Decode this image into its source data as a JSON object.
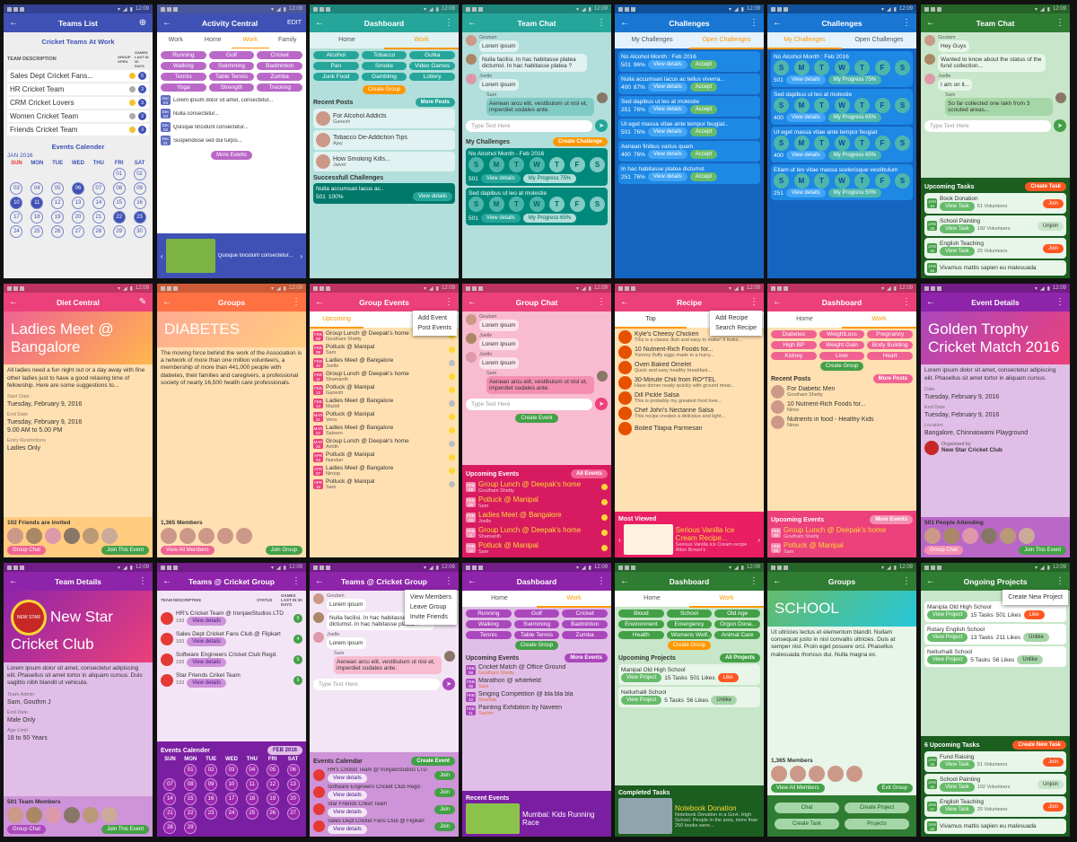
{
  "status_time": "12:09",
  "colors": {
    "indigo": "#3f51b5",
    "teal": "#26a69a",
    "blue": "#1565c0",
    "pink": "#ec407a",
    "orange": "#ff9800",
    "purple": "#8e24aa",
    "green": "#2e7d32"
  },
  "s1": {
    "title": "Teams List",
    "heading": "Cricket Teams At Work",
    "col_desc": "TEAM DESCRIPTION",
    "col_group": "GROUP OPEN",
    "col_games": "GAMES LAST IN 30 DAYS",
    "teams": [
      {
        "name": "Sales Dept Cricket Fans...",
        "n": "5"
      },
      {
        "name": "HR Cricket Team",
        "n": "3"
      },
      {
        "name": "CRM Cricket Lovers",
        "n": "3"
      },
      {
        "name": "Women Cricket Team",
        "n": "3"
      },
      {
        "name": "Friends Cricket Team",
        "n": "3"
      }
    ],
    "cal_title": "Events Calender",
    "month": "JAN 2016",
    "days": [
      "SUN",
      "MON",
      "TUE",
      "WED",
      "THU",
      "FRI",
      "SAT"
    ],
    "dates": [
      "",
      "",
      "",
      "",
      "",
      "01",
      "02",
      "03",
      "04",
      "05",
      "06",
      "07",
      "08",
      "09",
      "10",
      "11",
      "12",
      "13",
      "14",
      "15",
      "16",
      "17",
      "18",
      "19",
      "20",
      "21",
      "22",
      "23",
      "24",
      "25",
      "26",
      "27",
      "28",
      "29",
      "30"
    ]
  },
  "s2": {
    "title": "Activity Central",
    "action": "EDIT",
    "tabs": [
      "Work",
      "Home",
      "Work",
      "Family"
    ],
    "chips": [
      "Running",
      "Golf",
      "Cricket",
      "Walking",
      "Swimming",
      "Badminton",
      "Tennis",
      "Table Tennis",
      "Zumba",
      "Yoga",
      "Strength",
      "Trecking"
    ],
    "news": [
      {
        "d": "Dec 04",
        "t": "Lorem ipsum dolor sit amet, consectetur..."
      },
      {
        "d": "Dec 03",
        "t": "Nulla consectetur..."
      },
      {
        "d": "Dec 02",
        "t": "Quisque tincidunt consectetur..."
      },
      {
        "d": "Dec 01",
        "t": "Suspendisse sed dui turpis..."
      }
    ],
    "more": "More Events",
    "banner": "Quisque tincidunt consectetur..."
  },
  "s3": {
    "title": "Dashboard",
    "tabs": [
      "Home",
      "Work"
    ],
    "chips": [
      "Alcohol",
      "Tobacco",
      "Gutka",
      "Pan",
      "Smoke",
      "Video Games",
      "Junk Food",
      "Gambling",
      "Lottery"
    ],
    "create": "Create Group",
    "recent": "Recent Posts",
    "more": "More Posts",
    "posts": [
      {
        "t": "For Alcohol Addicts",
        "a": "Ganesh"
      },
      {
        "t": "Tobacco De-Addiction Tips",
        "a": "Ajay"
      },
      {
        "t": "How Smoking Kills...",
        "a": "Jaivet"
      }
    ],
    "sc": "Successfull Challenges",
    "sc_item": "Nulla accumsan lacus ac..",
    "sc_stats": "501",
    "sc_pct": "100%",
    "details": "View details"
  },
  "s4": {
    "title": "Team Chat",
    "msgs": [
      {
        "n": "Goutam",
        "t": "Lorem ipsum"
      },
      {
        "n": "",
        "t": "Nulla facilisi. In hac habitasse platea dictumst. In hac habitasse platea ?"
      },
      {
        "n": "Joelle",
        "t": "Lorem ipsum"
      },
      {
        "n": "Sam",
        "t": "Aenean arcu elit, vestibulum ut nisl et, imperdiet sodales ante."
      }
    ],
    "placeholder": "Type Text Here",
    "my": "My Challenges",
    "create": "Create Challenge",
    "c1": "No Alcohol Month - Feb 2016",
    "c2": "Sed dapibus ut leo at molestie",
    "smt": [
      "S",
      "M",
      "T",
      "W",
      "T",
      "F",
      "S"
    ],
    "stat": "501",
    "details": "View details",
    "progress": "My Progress 75%",
    "progress2": "My Progress 65%"
  },
  "s5": {
    "title": "Challenges",
    "tabs": [
      "My Challenges",
      "Open Challenges"
    ],
    "items": [
      {
        "t": "No Alcohol Month : Feb 2016",
        "c": "501",
        "p": "96%"
      },
      {
        "t": "Nulla accumsan lacus ac tellus viverra...",
        "c": "400",
        "p": "87%"
      },
      {
        "t": "Sed dapibus ut leo at molestie",
        "c": "251",
        "p": "76%"
      },
      {
        "t": "Ut eget massa vitae ante tempor feugiat..",
        "c": "501",
        "p": "76%"
      },
      {
        "t": "Aenean finibus varius quam",
        "c": "400",
        "p": "76%"
      },
      {
        "t": "In hac habitasse platea dictumst",
        "c": "251",
        "p": "76%"
      }
    ],
    "details": "View details",
    "accept": "Accept"
  },
  "s6": {
    "title": "Challenges",
    "tabs": [
      "My Challenges",
      "Open Challenges"
    ],
    "items": [
      {
        "t": "No Alcohol Month : Feb 2016",
        "c": "501",
        "p": "My Progress 75%"
      },
      {
        "t": "Sed dapibus ut leo at molestie",
        "c": "400",
        "p": "My Progress 65%"
      },
      {
        "t": "Ut eget massa vitae ante tempor feugiat",
        "c": "400",
        "p": "My Progress 65%"
      },
      {
        "t": "Etiam ut leo vitae massa scelerisque vestibulum",
        "c": "251",
        "p": "My Progress 50%"
      }
    ],
    "details": "View details",
    "smt": [
      "S",
      "M",
      "T",
      "W",
      "T",
      "F",
      "S"
    ]
  },
  "s7": {
    "title": "Team Chat",
    "msgs": [
      {
        "n": "Goutam",
        "t": "Hey Guys"
      },
      {
        "n": "",
        "t": "Wanted to know about the status of the fund collection..."
      },
      {
        "n": "Joelle",
        "t": "I am on it..."
      },
      {
        "n": "Sam",
        "t": "So far collected one lakh from 3 scouted areas..."
      }
    ],
    "placeholder": "Type Text Here",
    "up": "Upcoming Tasks",
    "create": "Create Task",
    "tasks": [
      {
        "d": "JAN 15",
        "t": "Book Donation",
        "v": "51 Volunteers",
        "b": "Join"
      },
      {
        "d": "JAN 15",
        "t": "School Painting",
        "v": "192 Volunteers",
        "b": "Unjoin"
      },
      {
        "d": "JAN 15",
        "t": "English Teaching",
        "v": "25 Volunteers",
        "b": "Join"
      },
      {
        "d": "JAN 15",
        "t": "Vivamus mattis sapien eu malesuada",
        "v": "",
        "b": ""
      }
    ],
    "view": "View Task"
  },
  "s8": {
    "title": "Diet Central",
    "hero": "Ladies Meet @ Bangalore",
    "desc": "All ladies need a fun night out or a day away with fine other ladies just to have a good relaxing time of fellowship. Here are some suggestions to...",
    "sd_l": "Start Date",
    "sd": "Tuesday, February 9, 2016",
    "ed_l": "End Date",
    "ed": "Tuesday, February 9, 2016",
    "time": "9.00 AM to 5.00 PM",
    "er_l": "Entry Restrictions",
    "er": "Ladies Only",
    "inv": "102 Friends are invited",
    "chat": "Group Chat",
    "join": "Join This Event"
  },
  "s9": {
    "title": "Groups",
    "hero": "DIABETES",
    "desc": "The moving force behind the work of the Association is a network of more than one million volunteers, a membership of more than 441,000 people with diabetes, their families and caregivers, a professional society of nearly 16,500 health care professionals.",
    "members": "1,365 Members",
    "view": "View All Members",
    "join": "Join Group"
  },
  "s10": {
    "title": "Group Events",
    "menu": [
      "Add Event",
      "Post Events"
    ],
    "tab": "Upcoming",
    "events": [
      {
        "d": "FEB 08",
        "t": "Group Lunch @ Deepak's home",
        "b": "Goutham Shetty"
      },
      {
        "d": "FEB 09",
        "t": "Potluck @ Manipal",
        "b": "Sam"
      },
      {
        "d": "FEB 10",
        "t": "Ladies Meet @ Bangalore",
        "b": "Joelle"
      },
      {
        "d": "FEB 11",
        "t": "Group Lunch @ Deepak's home",
        "b": "Shamanth"
      },
      {
        "d": "FEB 12",
        "t": "Potluck @ Manipal",
        "b": "Ganesh"
      },
      {
        "d": "FEB 14",
        "t": "Ladies Meet @ Bangalore",
        "b": "Maddi"
      },
      {
        "d": "MAR 21",
        "t": "Potluck @ Manipal",
        "b": "Venu"
      },
      {
        "d": "MAR 22",
        "t": "Ladies Meet @ Bangalore",
        "b": "Saleem"
      },
      {
        "d": "MAR 25",
        "t": "Group Lunch @ Deepak's home",
        "b": "Amith"
      },
      {
        "d": "APR 03",
        "t": "Potluck @ Manipal",
        "b": "Nandan"
      },
      {
        "d": "APR 07",
        "t": "Ladies Meet @ Bangalore",
        "b": "Niroop"
      },
      {
        "d": "APR 15",
        "t": "Potluck @ Manipal",
        "b": "Sam"
      }
    ],
    "created": "Created by"
  },
  "s11": {
    "title": "Group Chat",
    "msgs": [
      {
        "n": "Goutam",
        "t": "Lorem ipsum"
      },
      {
        "n": "Joelle",
        "t": "Lorem ipsum"
      },
      {
        "n": "Joelle",
        "t": "Lorem ipsum"
      },
      {
        "n": "Sam",
        "t": "Aenean arcu elit, vestibulum ut nisl et, imperdiet sodales ante."
      }
    ],
    "placeholder": "Type Text Here",
    "create": "Create Event",
    "up": "Upcoming Events",
    "all": "All Events",
    "events": [
      {
        "d": "FEB 08",
        "t": "Group Lunch @ Deepak's home",
        "b": "Goutham Shetty"
      },
      {
        "d": "FEB 09",
        "t": "Potluck @ Manipal",
        "b": "Sam"
      },
      {
        "d": "FEB 10",
        "t": "Ladies Meet @ Bangalore",
        "b": "Joelle"
      },
      {
        "d": "FEB 11",
        "t": "Group Lunch @ Deepak's home",
        "b": "Shamanth"
      },
      {
        "d": "FEB 12",
        "t": "Potluck @ Manipal",
        "b": "Sam"
      }
    ]
  },
  "s12": {
    "title": "Recipe",
    "menu": [
      "Add Recipe",
      "Search Recipe"
    ],
    "tab": "Top",
    "items": [
      {
        "t": "Kyle's Cheesy Chicken",
        "s": "This is a classic dish and easy to make! It looks..."
      },
      {
        "t": "10 Nutrient-Rich Foods for...",
        "s": "Yummy fluffy eggs made in a hurry..."
      },
      {
        "t": "Oven Baked Omelet",
        "s": "Quick and easy healthy breakfast..."
      },
      {
        "t": "30-Minute Chili from RO*TEL",
        "s": "Have dinner ready quickly with ground meat..."
      },
      {
        "t": "Dill Pickle Salsa",
        "s": "This is probably my greatest food love..."
      },
      {
        "t": "Chef John's Nectarine Salsa",
        "s": "This recipe creates a delicious and light..."
      },
      {
        "t": "Boiled Tilapia Parmesan",
        "s": ""
      }
    ],
    "mv": "Most Viewed",
    "mv_t": "Serious Vanilla Ice Cream Recipe...",
    "mv_s": "Serious Vanilla Ice Cream recipe Alton Brown's"
  },
  "s13": {
    "title": "Dashboard",
    "tabs": [
      "Home",
      "Work"
    ],
    "chips": [
      "Diabetes",
      "WeightLoss",
      "Pregnancy",
      "High BP",
      "Weight Gain",
      "Body Building",
      "Kidney",
      "Liver",
      "Heart"
    ],
    "create": "Create Group",
    "recent": "Recent Posts",
    "more": "More Posts",
    "posts": [
      {
        "t": "For Diabetic Men",
        "a": "Goutham Shetty"
      },
      {
        "t": "10 Nutrient-Rich Foods for...",
        "a": "Niroo"
      },
      {
        "t": "Nutrients in food - Healthy Kids",
        "a": "Niroo"
      }
    ],
    "up": "Upcoming Events",
    "more_ev": "More Events",
    "events": [
      {
        "d": "FEB 08",
        "t": "Group Lunch @ Deepak's home",
        "b": "Goutham Shetty"
      },
      {
        "d": "FEB 09",
        "t": "Potluck @ Manipal",
        "b": "Sam"
      }
    ]
  },
  "s14": {
    "title": "Event Details",
    "hero": "Golden Trophy Cricket Match 2016",
    "desc": "Lorem ipsum dolor sit amet, consectetur adipiscing elit. Phasellus sit amet tortor in aliquam cursus.",
    "d_l": "Date",
    "d": "Tuesday, February 9, 2016",
    "ed_l": "End Date",
    "ed": "Tuesday, February 9, 2016",
    "loc_l": "Location",
    "loc": "Bangalore, Chinnaswami Playground",
    "org_l": "Organised by",
    "org": "New Star Cricket Club",
    "att": "501 People Attending",
    "chat": "Group Chat",
    "join": "Join This Event"
  },
  "s15": {
    "title": "Team Details",
    "hero": "New Star Cricket Club",
    "logo": "NEW STAR",
    "desc": "Lorem ipsum dolor sit amet, consectetur adipiscing elit. Phasellus sit amet tortor in aliquam cursus. Duis sagittis nibh blandit ut vehicula.",
    "ad_l": "Team Admin",
    "ad": "Sam, Gouthm J",
    "ed_l": "End Date",
    "ed": "Male Only",
    "age_l": "Age Limit",
    "age": "18 to 50 Years",
    "members": "501 Team Members",
    "chat": "Group Chat",
    "join": "Join This Event"
  },
  "s16": {
    "title": "Teams @ Cricket Group",
    "cols": [
      "TEAM DESCRIPTION",
      "STATUS",
      "GAMES LAST IN 30 DAYS"
    ],
    "teams": [
      {
        "t": "HR's Cricket Team @ IronjawStudios LTD",
        "c": "193",
        "n": "5"
      },
      {
        "t": "Sales Dept Cricket Fans Club @ Flipkart",
        "c": "193",
        "n": "4"
      },
      {
        "t": "Software Engineers Cricket Club Regd.",
        "c": "193",
        "n": "5"
      },
      {
        "t": "Star Friends Criket Team",
        "c": "193",
        "n": "5"
      }
    ],
    "view": "View details",
    "cal": "Events Calender",
    "month": "FEB 2016",
    "days": [
      "SUN",
      "MON",
      "TUE",
      "WED",
      "THU",
      "FRI",
      "SAT"
    ],
    "dates": [
      "",
      "01",
      "02",
      "03",
      "04",
      "05",
      "06",
      "07",
      "08",
      "09",
      "10",
      "11",
      "12",
      "13",
      "14",
      "15",
      "16",
      "17",
      "18",
      "19",
      "20",
      "21",
      "22",
      "23",
      "24",
      "25",
      "26",
      "27",
      "28",
      "29"
    ]
  },
  "s17": {
    "title": "Teams @ Cricket Group",
    "menu": [
      "View Members",
      "Leave Group",
      "Invite Friends"
    ],
    "msgs": [
      {
        "n": "Goutam",
        "t": "Lorem ipsum"
      },
      {
        "n": "",
        "t": "Nulla facilisi. In hac habitasse platea dictumst. In hac habitasse platea ?"
      },
      {
        "n": "Joelle",
        "t": "Lorem ipsum"
      },
      {
        "n": "Sam",
        "t": "Aenean arcu elit, vestibulum ut nisl et, imperdiet sodales ante."
      }
    ],
    "placeholder": "Type Text Here",
    "cal": "Events Calendar",
    "create": "Create Event",
    "teams": [
      {
        "t": "HR's Cricket Team @ IronjawStudios LTD",
        "b": "Join"
      },
      {
        "t": "Software Engineers Cricket Club Regd.",
        "b": "Join"
      },
      {
        "t": "Star Friends Criket Team",
        "b": "Join"
      },
      {
        "t": "Sales Dept Cricket Fans Club @ Flipkart",
        "b": "Join"
      }
    ],
    "view": "View details"
  },
  "s18": {
    "title": "Dashboard",
    "tabs": [
      "Home",
      "Work"
    ],
    "chips": [
      "Running",
      "Golf",
      "Cricket",
      "Walking",
      "Swimming",
      "Badminton",
      "Tennis",
      "Table Tennis",
      "Zumba"
    ],
    "create": "Create Group",
    "up": "Upcoming Events",
    "more": "More Events",
    "events": [
      {
        "d": "FEB 08",
        "t": "Cricket Match @ Office Ground",
        "b": "Goutham Shetty"
      },
      {
        "d": "FEB 09",
        "t": "Marathon @ whitefield",
        "b": "Sam"
      },
      {
        "d": "FEB 10",
        "t": "Singing Competition @ bla bla bla",
        "b": "Shamila"
      },
      {
        "d": "FEB 11",
        "t": "Painting Exhibition by Naveen",
        "b": "Sachin"
      }
    ],
    "recent": "Recent Events",
    "re_t": "Mumbai: Kids Running Race"
  },
  "s19": {
    "title": "Dashboard",
    "tabs": [
      "Home",
      "Work"
    ],
    "chips": [
      "Blood",
      "School",
      "Old Age",
      "Environment",
      "Emergency",
      "Orgon Dona..",
      "Health",
      "Womens Welf..",
      "Animal Care"
    ],
    "create": "Create Group",
    "up": "Upcoming Projects",
    "all": "All Projects",
    "projects": [
      {
        "t": "Manipal Old High School",
        "tasks": "15 Tasks",
        "likes": "501 Likes",
        "b": "Like"
      },
      {
        "t": "Nellurhalli School",
        "tasks": "5 Tasks",
        "likes": "56 Likes",
        "b": "Unlike"
      }
    ],
    "vp": "View Project",
    "completed": "Completed Tasks",
    "ct": "Notebook Donation",
    "cd": "Notebook Donation in a Govt. High School. People in the area, more than 250 books were..."
  },
  "s20": {
    "title": "Groups",
    "hero": "SCHOOL",
    "desc": "Ut ultricies lectus et elementum blandit. Nullam consequat justo in nisl convallis ultricies. Duis at semper nisl. Proin eget posuere orci. Phasellus malesuada rhoncus dui. Nulla magna ex.",
    "members": "1,365 Members",
    "view": "View All Members",
    "exit": "Exit Group",
    "buttons": [
      "Chat",
      "Create Project",
      "Create Task",
      "Projects"
    ]
  },
  "s21": {
    "title": "Ongoing Projects",
    "menu": "Create New Project",
    "projects": [
      {
        "t": "Manipla Old High School",
        "tasks": "15 Tasks",
        "likes": "501 Likes",
        "b": "Like"
      },
      {
        "t": "Rotary English School",
        "tasks": "13 Tasks",
        "likes": "211 Likes",
        "b": "Unlike"
      },
      {
        "t": "Nellurhalli School",
        "tasks": "5 Tasks",
        "likes": "56 Likes",
        "b": "Unlike"
      }
    ],
    "vp": "View Project",
    "up": "6 Upcoming Tasks",
    "create": "Create New Task",
    "tasks": [
      {
        "d": "JAN 15",
        "t": "Fund Raising",
        "v": "51 Volunteers",
        "b": "Join"
      },
      {
        "d": "JAN 16",
        "t": "School Painting",
        "v": "192 Volunteers",
        "b": "Unjoin"
      },
      {
        "d": "JAN 17",
        "t": "English Teaching",
        "v": "25 Volunteers",
        "b": "Join"
      },
      {
        "d": "JAN 18",
        "t": "Vivamus mattis sapien eu malesuada",
        "v": "",
        "b": ""
      }
    ],
    "view": "View Task"
  }
}
